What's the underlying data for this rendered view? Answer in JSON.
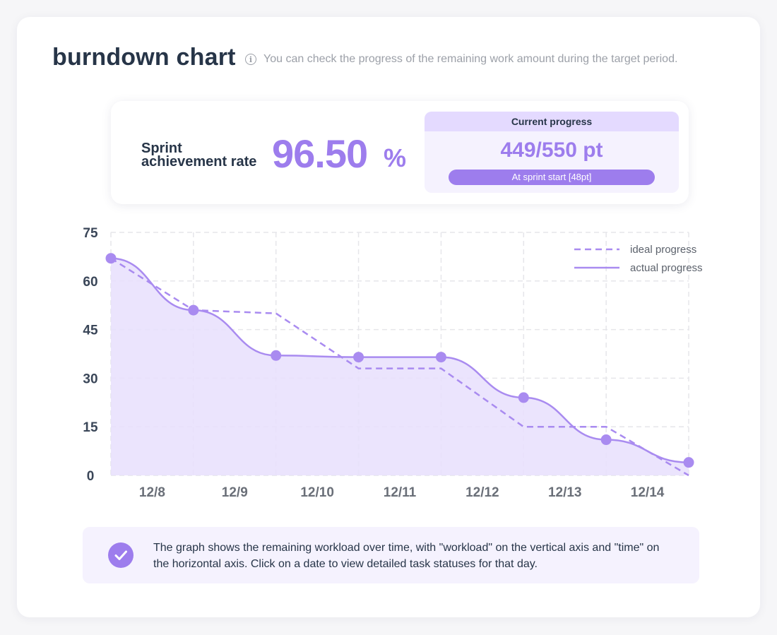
{
  "header": {
    "title": "burndown chart",
    "info_icon": "info-icon",
    "subtitle": "You can check the progress of the remaining work amount during the target period."
  },
  "summary": {
    "rate_label_line1": "Sprint",
    "rate_label_line2": "achievement rate",
    "rate_value": "96.50",
    "rate_unit": "%",
    "progress_title": "Current progress",
    "progress_value": "449/550 pt",
    "progress_note": "At sprint start [48pt]"
  },
  "colors": {
    "accent": "#9d7ded",
    "point": "#a98bf0",
    "area_fill": "#e8dffd",
    "grid": "#e6e6ea",
    "text_dark": "#273548"
  },
  "chart_data": {
    "type": "line",
    "x": [
      "12/8",
      "12/9",
      "12/10",
      "12/11",
      "12/12",
      "12/13",
      "12/14"
    ],
    "ylim": [
      0,
      75
    ],
    "yticks": [
      0,
      15,
      30,
      45,
      60,
      75
    ],
    "grid": true,
    "legend_position": "top-right",
    "series": [
      {
        "name": "ideal progress",
        "style": "dashed",
        "points": [
          [
            0,
            67
          ],
          [
            1,
            51
          ],
          [
            2,
            50
          ],
          [
            3,
            33
          ],
          [
            4,
            33
          ],
          [
            5,
            15
          ],
          [
            6,
            15
          ],
          [
            7,
            0
          ]
        ]
      },
      {
        "name": "actual progress",
        "style": "solid",
        "points": [
          [
            0,
            67
          ],
          [
            1,
            51
          ],
          [
            2,
            37
          ],
          [
            3,
            36.5
          ],
          [
            4,
            36.5
          ],
          [
            5,
            24
          ],
          [
            6,
            11
          ],
          [
            7,
            4
          ]
        ]
      }
    ]
  },
  "footer_note": {
    "icon": "check-icon",
    "text": "The graph shows the remaining workload over time, with \"workload\" on the vertical axis and \"time\" on the horizontal axis. Click on a date to view detailed task statuses for that day."
  }
}
